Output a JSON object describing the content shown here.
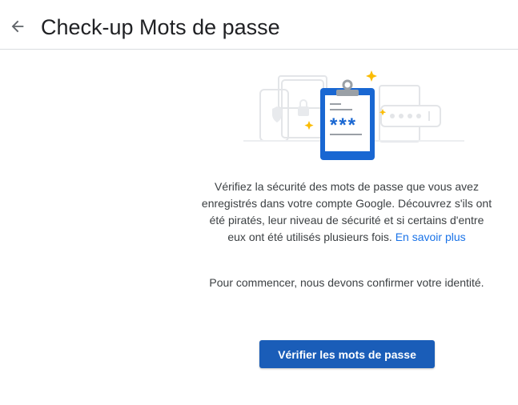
{
  "header": {
    "title": "Check-up Mots de passe",
    "back_icon": "arrow-back-icon"
  },
  "illustration": {
    "masked_password": "***",
    "icon": "clipboard-password-illustration"
  },
  "main": {
    "description": "Vérifiez la sécurité des mots de passe que vous avez enregistrés dans votre compte Google. Découvrez s'ils ont été piratés, leur niveau de sécurité et si certains d'entre eux ont été utilisés plusieurs fois.",
    "learn_more_link": "En savoir plus",
    "identity_text": "Pour commencer, nous devons confirmer votre identité.",
    "check_button": "Vérifier les mots de passe"
  },
  "colors": {
    "accent": "#1a73e8",
    "button": "#1a5db8",
    "star": "#fbbc04"
  }
}
